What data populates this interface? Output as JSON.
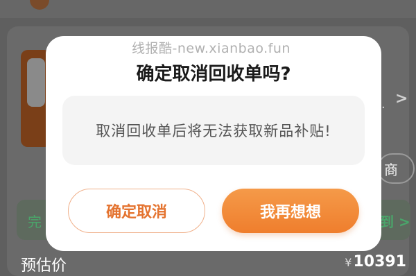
{
  "watermark": "线报酷-new.xianbao.fun",
  "background": {
    "est_label": "预估价",
    "price_symbol": "¥",
    "price_value": "10391",
    "pill_text": "商",
    "green_left": "完",
    "green_right": "到 >",
    "chevron": ">",
    "dot": "."
  },
  "dialog": {
    "title": "确定取消回收单吗?",
    "message": "取消回收单后将无法获取新品补贴!",
    "confirm_label": "确定取消",
    "think_label": "我再想想"
  },
  "colors": {
    "accent": "#ef7e2d",
    "green": "#4aa56a"
  }
}
